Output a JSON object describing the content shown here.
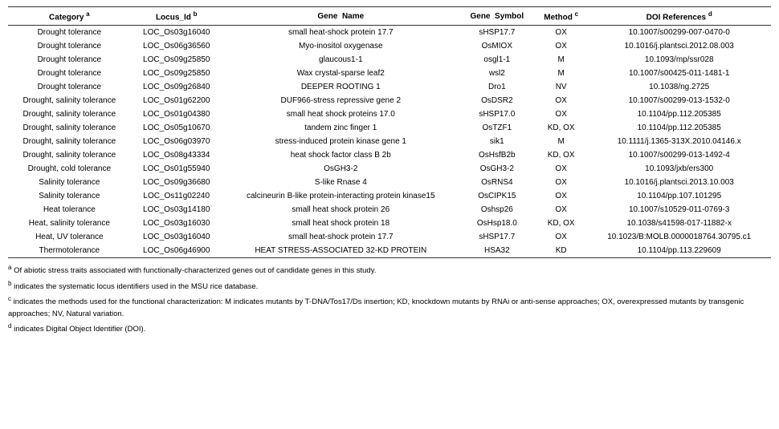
{
  "table": {
    "headers": [
      {
        "label": "Category",
        "sup": "a"
      },
      {
        "label": "Locus_Id",
        "sup": "b"
      },
      {
        "label": "Gene  Name",
        "sup": ""
      },
      {
        "label": "Gene  Symbol",
        "sup": ""
      },
      {
        "label": "Method",
        "sup": "c"
      },
      {
        "label": "DOI References",
        "sup": "d"
      }
    ],
    "rows": [
      {
        "category": "Drought tolerance",
        "locus": "LOC_Os03g16040",
        "gene": "small heat-shock protein 17.7",
        "symbol": "sHSP17.7",
        "method": "OX",
        "doi": "10.1007/s00299-007-0470-0"
      },
      {
        "category": "Drought tolerance",
        "locus": "LOC_Os06g36560",
        "gene": "Myo-inositol oxygenase",
        "symbol": "OsMIOX",
        "method": "OX",
        "doi": "10.1016/j.plantsci.2012.08.003"
      },
      {
        "category": "Drought tolerance",
        "locus": "LOC_Os09g25850",
        "gene": "glaucous1-1",
        "symbol": "osgl1-1",
        "method": "M",
        "doi": "10.1093/mp/ssr028"
      },
      {
        "category": "Drought tolerance",
        "locus": "LOC_Os09g25850",
        "gene": "Wax crystal-sparse leaf2",
        "symbol": "wsl2",
        "method": "M",
        "doi": "10.1007/s00425-011-1481-1"
      },
      {
        "category": "Drought tolerance",
        "locus": "LOC_Os09g26840",
        "gene": "DEEPER ROOTING 1",
        "symbol": "Dro1",
        "method": "NV",
        "doi": "10.1038/ng.2725"
      },
      {
        "category": "Drought, salinity tolerance",
        "locus": "LOC_Os01g62200",
        "gene": "DUF966-stress repressive gene 2",
        "symbol": "OsDSR2",
        "method": "OX",
        "doi": "10.1007/s00299-013-1532-0"
      },
      {
        "category": "Drought, salinity tolerance",
        "locus": "LOC_Os01g04380",
        "gene": "small heat shock proteins 17.0",
        "symbol": "sHSP17.0",
        "method": "OX",
        "doi": "10.1104/pp.112.205385"
      },
      {
        "category": "Drought, salinity tolerance",
        "locus": "LOC_Os05g10670",
        "gene": "tandem zinc finger 1",
        "symbol": "OsTZF1",
        "method": "KD, OX",
        "doi": "10.1104/pp.112.205385"
      },
      {
        "category": "Drought, salinity tolerance",
        "locus": "LOC_Os06g03970",
        "gene": "stress-induced protein kinase gene 1",
        "symbol": "sik1",
        "method": "M",
        "doi": "10.1111/j.1365-313X.2010.04146.x"
      },
      {
        "category": "Drought, salinity tolerance",
        "locus": "LOC_Os08g43334",
        "gene": "heat shock factor class B 2b",
        "symbol": "OsHsfB2b",
        "method": "KD, OX",
        "doi": "10.1007/s00299-013-1492-4"
      },
      {
        "category": "Drought, cold tolerance",
        "locus": "LOC_Os01g55940",
        "gene": "OsGH3-2",
        "symbol": "OsGH3-2",
        "method": "OX",
        "doi": "10.1093/jxb/ers300"
      },
      {
        "category": "Salinity tolerance",
        "locus": "LOC_Os09g36680",
        "gene": "S-like Rnase 4",
        "symbol": "OsRNS4",
        "method": "OX",
        "doi": "10.1016/j.plantsci.2013.10.003"
      },
      {
        "category": "Salinity tolerance",
        "locus": "LOC_Os11g02240",
        "gene": "calcineurin B-like protein-interacting protein kinase15",
        "symbol": "OsCIPK15",
        "method": "OX",
        "doi": "10.1104/pp.107.101295"
      },
      {
        "category": "Heat tolerance",
        "locus": "LOC_Os03g14180",
        "gene": "small heat shock protein 26",
        "symbol": "Oshsp26",
        "method": "OX",
        "doi": "10.1007/s10529-011-0769-3"
      },
      {
        "category": "Heat, salinity tolerance",
        "locus": "LOC_Os03g16030",
        "gene": "small heat shock protein 18",
        "symbol": "OsHsp18.0",
        "method": "KD, OX",
        "doi": "10.1038/s41598-017-11882-x"
      },
      {
        "category": "Heat, UV tolerance",
        "locus": "LOC_Os03g16040",
        "gene": "small heat-shock protein 17.7",
        "symbol": "sHSP17.7",
        "method": "OX",
        "doi": "10.1023/B:MOLB.0000018764.30795.c1"
      },
      {
        "category": "Thermotolerance",
        "locus": "LOC_Os06g46900",
        "gene": "HEAT STRESS-ASSOCIATED 32-KD PROTEIN",
        "symbol": "HSA32",
        "method": "KD",
        "doi": "10.1104/pp.113.229609"
      }
    ]
  },
  "footnotes": [
    {
      "sup": "a",
      "text": "Of abiotic stress traits associated with functionally-characterized genes out of candidate genes in this study."
    },
    {
      "sup": "b",
      "text": "indicates the systematic locus identifiers used in the MSU rice database."
    },
    {
      "sup": "c",
      "text": "indicates the methods used for the functional characterization: M indicates mutants by T-DNA/Tos17/Ds insertion; KD, knockdown mutants by RNAi or anti-sense approaches; OX, overexpressed mutants by transgenic approaches; NV, Natural variation."
    },
    {
      "sup": "d",
      "text": "indicates Digital Object Identifier (DOI)."
    }
  ]
}
